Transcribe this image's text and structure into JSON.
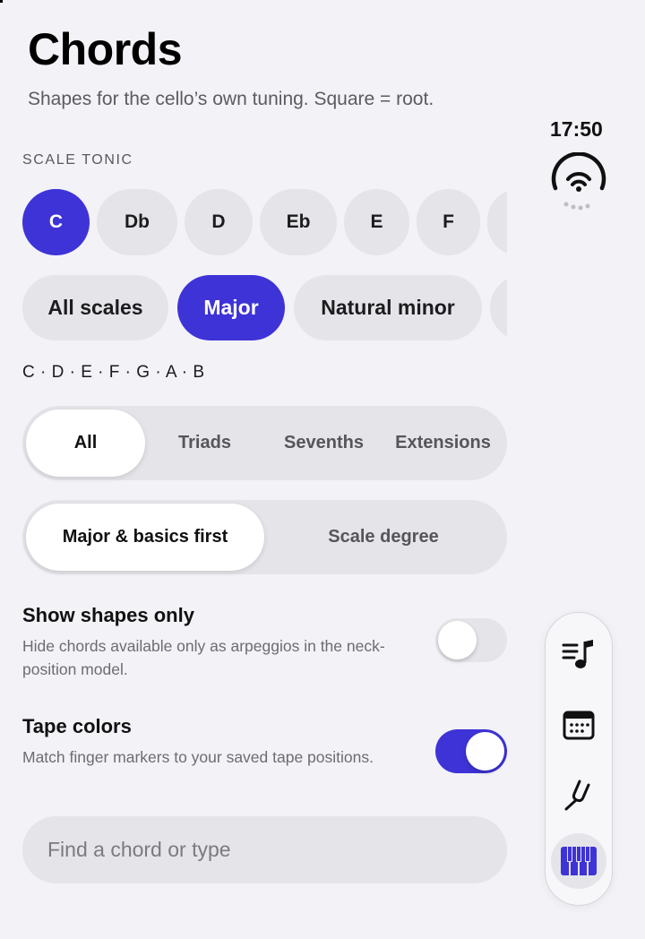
{
  "header": {
    "title": "Chords",
    "subtitle": "Shapes for the cello’s own tuning. Square = root."
  },
  "tonic": {
    "label": "SCALE TONIC",
    "items": [
      "C",
      "Db",
      "D",
      "Eb",
      "E",
      "F"
    ],
    "selected": "C"
  },
  "scales": {
    "items": [
      "All scales",
      "Major",
      "Natural minor"
    ],
    "selected": "Major"
  },
  "scale_notes": "C · D · E · F · G · A · B",
  "chord_filter": {
    "items": [
      "All",
      "Triads",
      "Sevenths",
      "Extensions"
    ],
    "selected": "All"
  },
  "sort_order": {
    "items": [
      "Major & basics first",
      "Scale degree"
    ],
    "selected": "Major & basics first"
  },
  "toggles": {
    "shapes_only": {
      "title": "Show shapes only",
      "description": "Hide chords available only as arpeggios in the neck-position model.",
      "on": false
    },
    "tape_colors": {
      "title": "Tape colors",
      "description": "Match finger markers to your saved tape positions.",
      "on": true
    }
  },
  "search": {
    "placeholder": "Find a chord or type",
    "value": ""
  },
  "status": {
    "time": "17:50"
  },
  "tabs": [
    {
      "icon": "music-list-icon"
    },
    {
      "icon": "calendar-icon"
    },
    {
      "icon": "tuning-fork-icon"
    },
    {
      "icon": "piano-keys-icon",
      "active": true
    }
  ],
  "colors": {
    "accent": "#3e33d6",
    "background": "#f2f2f7",
    "chip": "#e4e4e9"
  }
}
